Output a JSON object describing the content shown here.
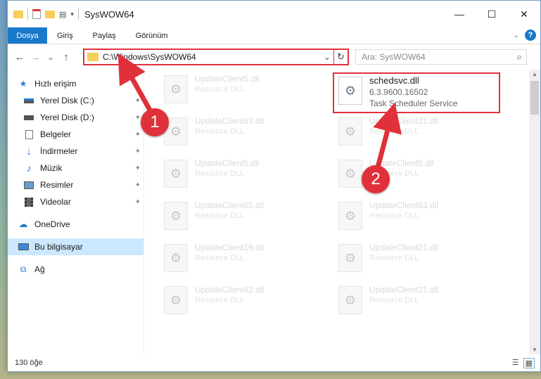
{
  "window": {
    "title": "SysWOW64",
    "controls": {
      "minimize": "—",
      "maximize": "☐",
      "close": "✕"
    }
  },
  "ribbon": {
    "tabs": [
      "Dosya",
      "Giriş",
      "Paylaş",
      "Görünüm"
    ],
    "help": "?"
  },
  "nav": {
    "back": "←",
    "forward": "→",
    "recent": "⌄",
    "up": "↑",
    "address": "C:\\Windows\\SysWOW64",
    "search_placeholder": "Ara: SysWOW64"
  },
  "sidebar": {
    "quick_access": "Hızlı erişim",
    "items": [
      {
        "label": "Yerel Disk (C:)",
        "icon": "drive-icon",
        "pinned": true
      },
      {
        "label": "Yerel Disk (D:)",
        "icon": "drive-icon",
        "pinned": true
      },
      {
        "label": "Belgeler",
        "icon": "documents-icon",
        "pinned": true
      },
      {
        "label": "İndirmeler",
        "icon": "downloads-icon",
        "pinned": true
      },
      {
        "label": "Müzik",
        "icon": "music-icon",
        "pinned": true
      },
      {
        "label": "Resimler",
        "icon": "pictures-icon",
        "pinned": true
      },
      {
        "label": "Videolar",
        "icon": "videos-icon",
        "pinned": true
      }
    ],
    "onedrive": "OneDrive",
    "this_pc": "Bu bilgisayar",
    "network": "Ağ"
  },
  "files": {
    "left": [
      {
        "name": "UpdateClient5.dll",
        "desc": "Resource DLL"
      },
      {
        "name": "UpdateClient63.dll",
        "desc": "Resource DLL"
      },
      {
        "name": "UpdateClient5.dll",
        "desc": "Resource DLL"
      },
      {
        "name": "UpdateClient65.dll",
        "desc": "Resource DLL"
      },
      {
        "name": "UpdateClient19.dll",
        "desc": "Resource DLL"
      },
      {
        "name": "UpdateClient42.dll",
        "desc": "Resource DLL"
      }
    ],
    "highlighted": {
      "name": "schedsvc.dll",
      "version": "6.3.9600.16502",
      "desc": "Task Scheduler Service"
    },
    "right": [
      {
        "name": "UpdateClient21.dll",
        "desc": "Resource DLL"
      },
      {
        "name": "UpdateClient5.dll",
        "desc": "Resource DLL"
      },
      {
        "name": "UpdateClient63.dll",
        "desc": "Resource DLL"
      },
      {
        "name": "UpdateClient21.dll",
        "desc": "Resource DLL"
      },
      {
        "name": "UpdateClient21.dll",
        "desc": "Resource DLL"
      }
    ]
  },
  "status": {
    "count": "130 öğe"
  },
  "callouts": {
    "one": "1",
    "two": "2"
  },
  "colors": {
    "accent": "#1979ca",
    "highlight": "#e0313b",
    "selected": "#cce8ff"
  }
}
